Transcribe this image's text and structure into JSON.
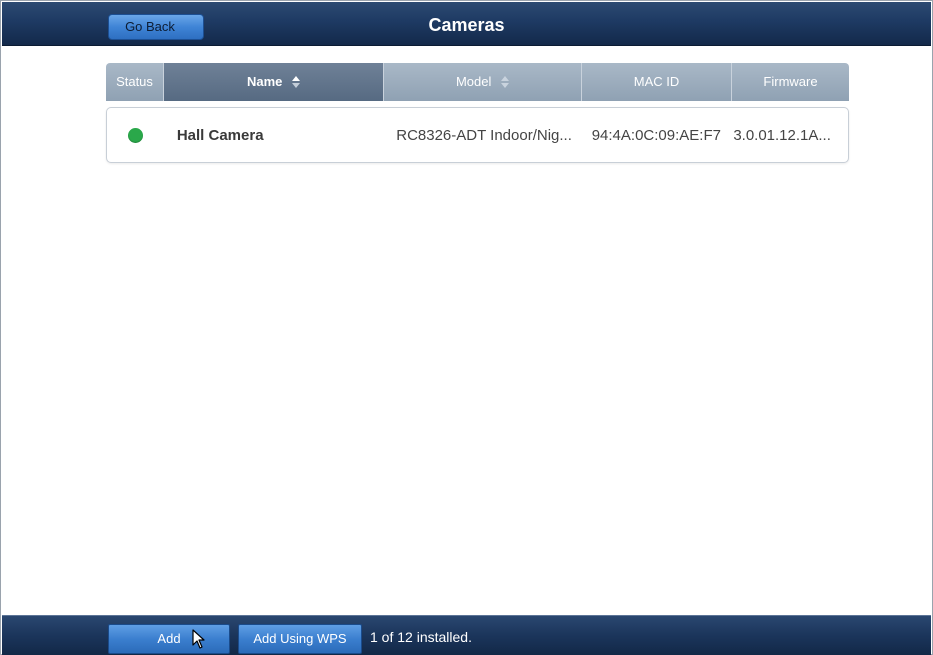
{
  "header": {
    "title": "Cameras",
    "back_label": "Go Back"
  },
  "table": {
    "columns": [
      "Status",
      "Name",
      "Model",
      "MAC ID",
      "Firmware"
    ],
    "sorted_column": "Name",
    "rows": [
      {
        "status": "online",
        "status_color": "#2aa84a",
        "name": "Hall Camera",
        "model": "RC8326-ADT Indoor/Nig...",
        "mac": "94:4A:0C:09:AE:F7",
        "firmware": "3.0.01.12.1A..."
      }
    ]
  },
  "footer": {
    "add_label": "Add",
    "add_wps_label": "Add Using WPS",
    "installed_text": "1 of 12 installed."
  },
  "colors": {
    "header_bg": "#1e3a63",
    "button_blue": "#3b7fcf",
    "column_header": "#8fa1b3",
    "column_header_active": "#566a82",
    "status_online": "#2aa84a"
  },
  "icons": {
    "sort": "sort-arrows-icon",
    "cursor": "mouse-pointer-icon"
  }
}
